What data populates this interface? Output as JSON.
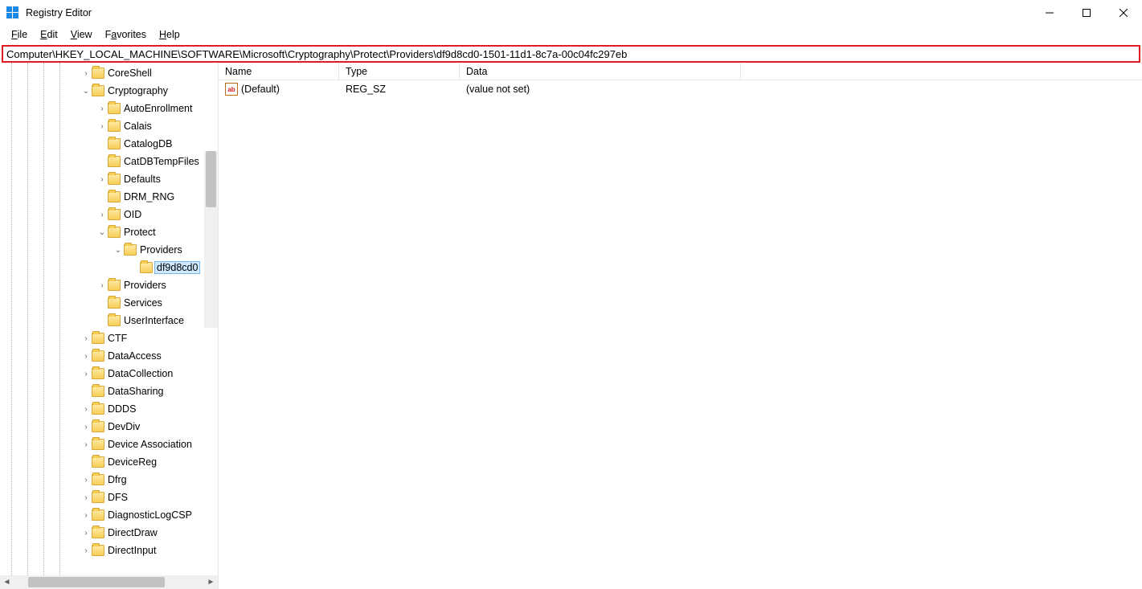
{
  "app": {
    "title": "Registry Editor"
  },
  "menu": {
    "file": "File",
    "edit": "Edit",
    "view": "View",
    "favorites": "Favorites",
    "help": "Help"
  },
  "address": "Computer\\HKEY_LOCAL_MACHINE\\SOFTWARE\\Microsoft\\Cryptography\\Protect\\Providers\\df9d8cd0-1501-11d1-8c7a-00c04fc297eb",
  "tree": {
    "items": [
      {
        "indent": 5,
        "chev": ">",
        "label": "CoreShell"
      },
      {
        "indent": 5,
        "chev": "v",
        "label": "Cryptography"
      },
      {
        "indent": 6,
        "chev": ">",
        "label": "AutoEnrollment"
      },
      {
        "indent": 6,
        "chev": ">",
        "label": "Calais"
      },
      {
        "indent": 6,
        "chev": "",
        "label": "CatalogDB"
      },
      {
        "indent": 6,
        "chev": "",
        "label": "CatDBTempFiles"
      },
      {
        "indent": 6,
        "chev": ">",
        "label": "Defaults"
      },
      {
        "indent": 6,
        "chev": "",
        "label": "DRM_RNG"
      },
      {
        "indent": 6,
        "chev": ">",
        "label": "OID"
      },
      {
        "indent": 6,
        "chev": "v",
        "label": "Protect"
      },
      {
        "indent": 7,
        "chev": "v",
        "label": "Providers"
      },
      {
        "indent": 8,
        "chev": "",
        "label": "df9d8cd0",
        "selected": true
      },
      {
        "indent": 6,
        "chev": ">",
        "label": "Providers"
      },
      {
        "indent": 6,
        "chev": "",
        "label": "Services"
      },
      {
        "indent": 6,
        "chev": "",
        "label": "UserInterface"
      },
      {
        "indent": 5,
        "chev": ">",
        "label": "CTF"
      },
      {
        "indent": 5,
        "chev": ">",
        "label": "DataAccess"
      },
      {
        "indent": 5,
        "chev": ">",
        "label": "DataCollection"
      },
      {
        "indent": 5,
        "chev": "",
        "label": "DataSharing"
      },
      {
        "indent": 5,
        "chev": ">",
        "label": "DDDS"
      },
      {
        "indent": 5,
        "chev": ">",
        "label": "DevDiv"
      },
      {
        "indent": 5,
        "chev": ">",
        "label": "Device Association"
      },
      {
        "indent": 5,
        "chev": "",
        "label": "DeviceReg"
      },
      {
        "indent": 5,
        "chev": ">",
        "label": "Dfrg"
      },
      {
        "indent": 5,
        "chev": ">",
        "label": "DFS"
      },
      {
        "indent": 5,
        "chev": ">",
        "label": "DiagnosticLogCSP"
      },
      {
        "indent": 5,
        "chev": ">",
        "label": "DirectDraw"
      },
      {
        "indent": 5,
        "chev": ">",
        "label": "DirectInput"
      }
    ]
  },
  "columns": {
    "name": "Name",
    "type": "Type",
    "data": "Data"
  },
  "values": [
    {
      "name": "(Default)",
      "type": "REG_SZ",
      "data": "(value not set)"
    }
  ]
}
